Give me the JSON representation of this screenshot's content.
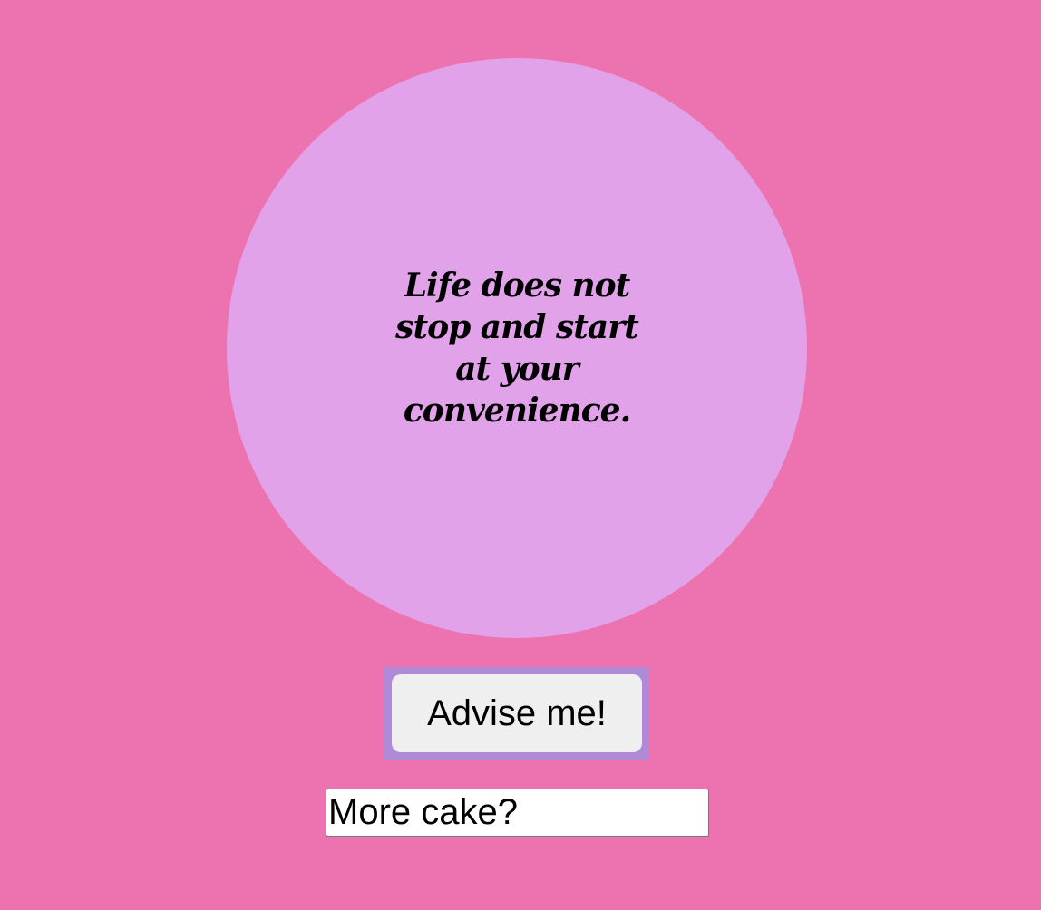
{
  "advice": {
    "quote": "Life does not stop and start at your convenience."
  },
  "controls": {
    "advise_button_label": "Advise me!",
    "input_value": "More cake?"
  },
  "colors": {
    "background": "#ed72b0",
    "circle": "#e2a2ea",
    "button_frame": "#b08ad8",
    "button": "#efefef"
  }
}
